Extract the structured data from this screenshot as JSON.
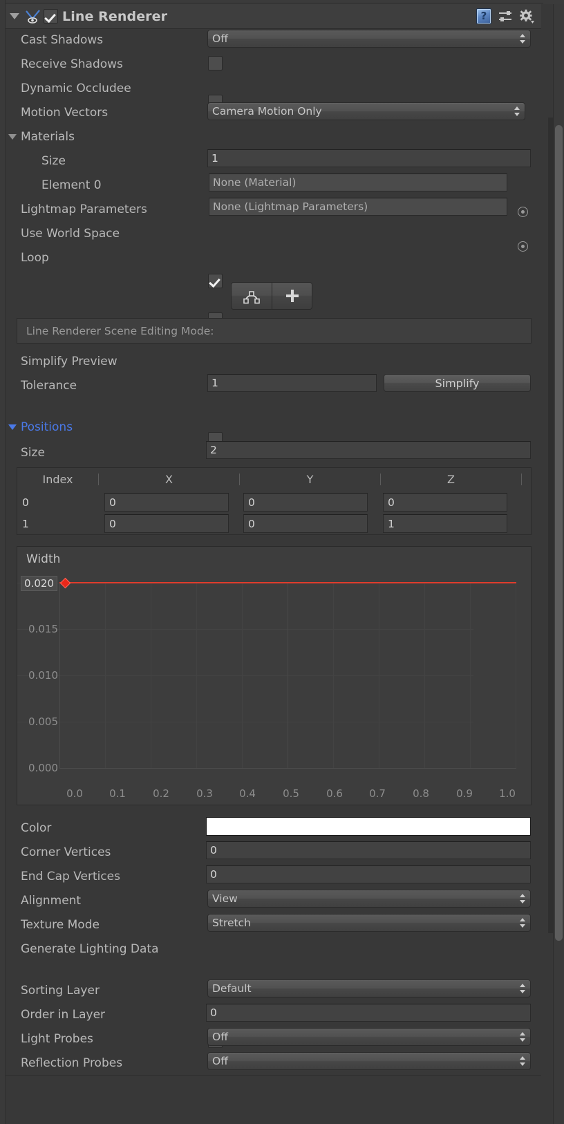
{
  "component": {
    "title": "Line Renderer",
    "enabled": true,
    "foldout_open": true,
    "icons": {
      "foldout": "triangle-down-icon",
      "type": "line-renderer-icon",
      "help": "help-book-icon",
      "preset": "preset-sliders-icon",
      "settings": "gear-icon"
    }
  },
  "rendering": {
    "cast_shadows": {
      "label": "Cast Shadows",
      "value": "Off"
    },
    "receive_shadows": {
      "label": "Receive Shadows",
      "checked": false
    },
    "dynamic_occludee": {
      "label": "Dynamic Occludee",
      "checked": false
    },
    "motion_vectors": {
      "label": "Motion Vectors",
      "value": "Camera Motion Only"
    }
  },
  "materials": {
    "label": "Materials",
    "size": {
      "label": "Size",
      "value": "1"
    },
    "element0": {
      "label": "Element 0",
      "value": "None (Material)"
    }
  },
  "lightmap_parameters": {
    "label": "Lightmap Parameters",
    "value": "None (Lightmap Parameters)"
  },
  "use_world_space": {
    "label": "Use World Space",
    "checked": true
  },
  "loop": {
    "label": "Loop",
    "checked": false
  },
  "edit_mode": {
    "edit_points_icon": "edit-points-icon",
    "create_points_icon": "plus-icon",
    "help_text": "Line Renderer Scene Editing Mode:"
  },
  "simplify_preview": {
    "label": "Simplify Preview",
    "checked": false
  },
  "tolerance": {
    "label": "Tolerance",
    "value": "1"
  },
  "simplify_button": {
    "label": "Simplify"
  },
  "positions": {
    "label": "Positions",
    "size": {
      "label": "Size",
      "value": "2"
    },
    "columns": [
      "Index",
      "X",
      "Y",
      "Z"
    ],
    "rows": [
      {
        "index": "0",
        "x": "0",
        "y": "0",
        "z": "0"
      },
      {
        "index": "1",
        "x": "0",
        "y": "0",
        "z": "1"
      }
    ]
  },
  "chart_data": {
    "type": "line",
    "title": "Width",
    "xlabel": "",
    "ylabel": "",
    "x": [
      0.0,
      1.0
    ],
    "values": [
      0.02,
      0.02
    ],
    "series": [
      {
        "name": "Width",
        "values": [
          0.02,
          0.02
        ],
        "color": "#e03c2c"
      }
    ],
    "keyframes": [
      {
        "time": 0.0,
        "value": 0.02
      }
    ],
    "ytick_labels": [
      "0.020",
      "0.015",
      "0.010",
      "0.005",
      "0.000"
    ],
    "ytick_values": [
      0.02,
      0.015,
      0.01,
      0.005,
      0.0
    ],
    "xtick_labels": [
      "0.0",
      "0.1",
      "0.2",
      "0.3",
      "0.4",
      "0.5",
      "0.6",
      "0.7",
      "0.8",
      "0.9",
      "1.0"
    ],
    "xtick_values": [
      0.0,
      0.1,
      0.2,
      0.3,
      0.4,
      0.5,
      0.6,
      0.7,
      0.8,
      0.9,
      1.0
    ],
    "xlim": [
      0.0,
      1.0
    ],
    "ylim": [
      0.0,
      0.02
    ],
    "grid": true,
    "legend": "none"
  },
  "appearance": {
    "color": {
      "label": "Color",
      "value": "#ffffff"
    },
    "corner_vertices": {
      "label": "Corner Vertices",
      "value": "0"
    },
    "end_cap_vertices": {
      "label": "End Cap Vertices",
      "value": "0"
    },
    "alignment": {
      "label": "Alignment",
      "value": "View"
    },
    "texture_mode": {
      "label": "Texture Mode",
      "value": "Stretch"
    },
    "generate_lighting_data": {
      "label": "Generate Lighting Data",
      "checked": false
    }
  },
  "sorting": {
    "sorting_layer": {
      "label": "Sorting Layer",
      "value": "Default"
    },
    "order_in_layer": {
      "label": "Order in Layer",
      "value": "0"
    },
    "light_probes": {
      "label": "Light Probes",
      "value": "Off"
    },
    "reflection_probes": {
      "label": "Reflection Probes",
      "value": "Off"
    }
  },
  "colors": {
    "panel_bg": "#383838",
    "header_bg": "#3e3e3e",
    "accent_blue": "#4a79e8",
    "curve_red": "#e03c2c",
    "field_bg": "#424242"
  }
}
